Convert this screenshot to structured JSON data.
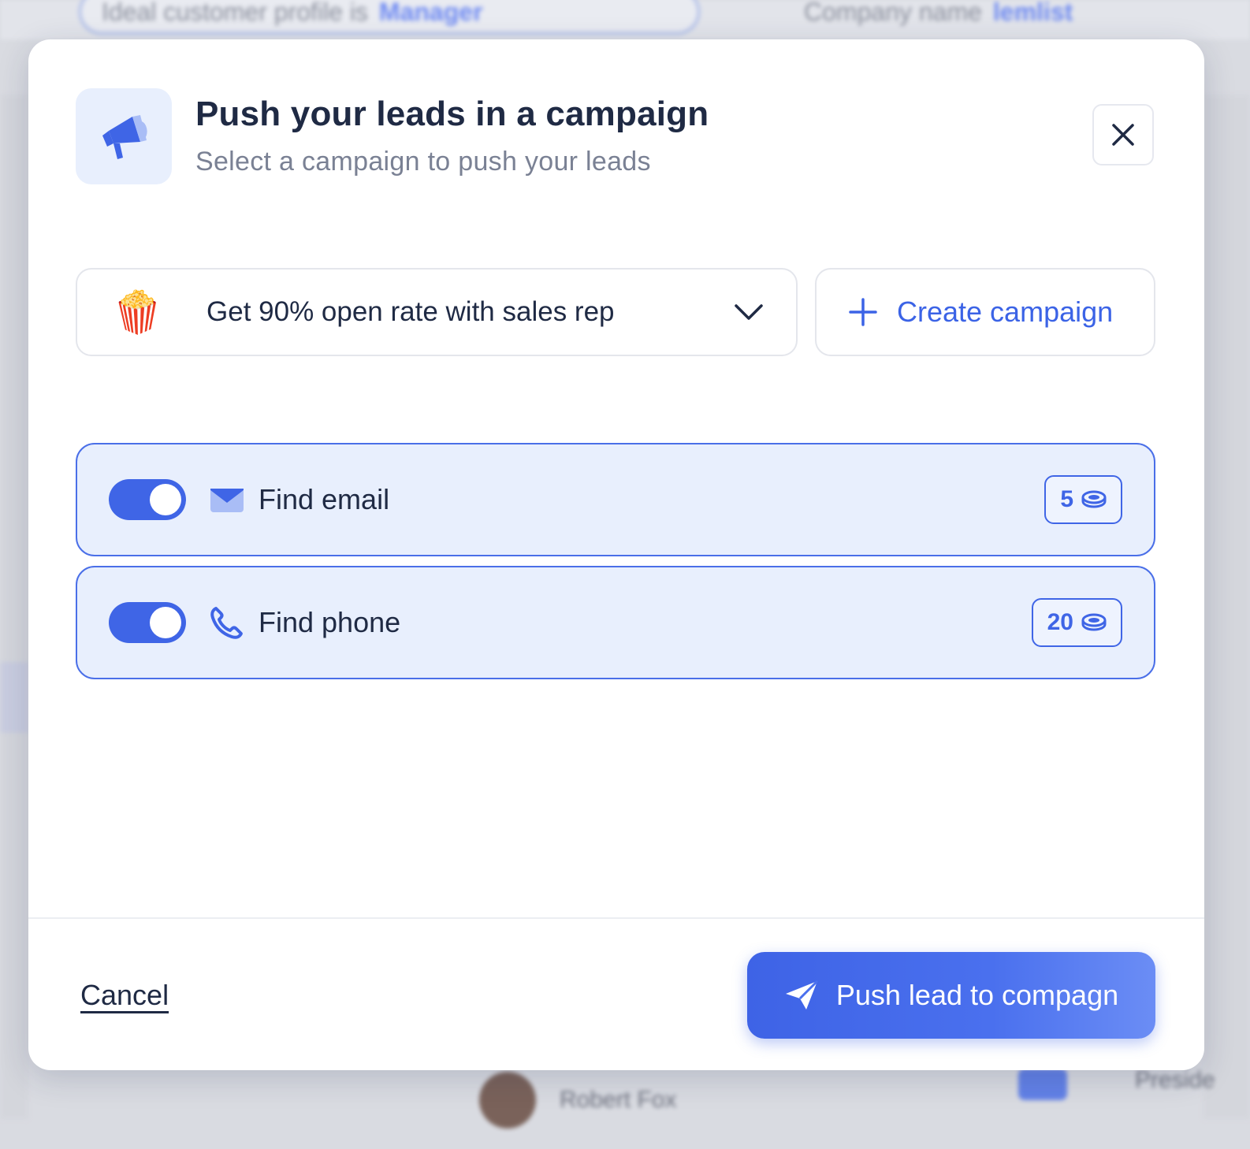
{
  "background": {
    "filter_chip": {
      "label": "Ideal customer profile is",
      "value": "Manager"
    },
    "filter_chip2": {
      "label": "Company name",
      "value": "lemlist"
    },
    "row_name": "Robert Fox",
    "row_role": "Preside"
  },
  "modal": {
    "title": "Push your leads in a campaign",
    "subtitle": "Select a campaign to push your leads",
    "campaign_select": {
      "emoji": "🍿",
      "value": "Get 90% open rate with sales rep"
    },
    "create_label": "Create campaign",
    "options": [
      {
        "label": "Find email",
        "cost": "5",
        "enabled": true
      },
      {
        "label": "Find phone",
        "cost": "20",
        "enabled": true
      }
    ],
    "cancel_label": "Cancel",
    "push_label": "Push lead to compagn"
  },
  "colors": {
    "accent": "#3f65e6",
    "option_bg": "#e8effd",
    "title": "#1f2a44"
  }
}
